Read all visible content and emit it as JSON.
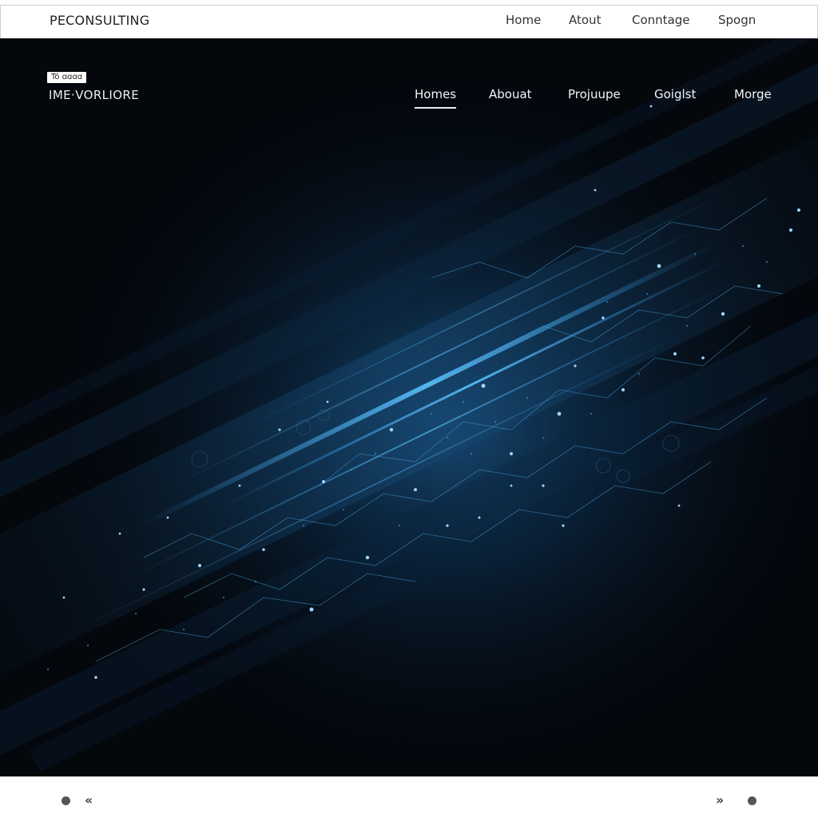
{
  "top_bar": {
    "logo": "PECONSULTING",
    "nav": [
      "Home",
      "Atout",
      "Conntage",
      "Spogn"
    ]
  },
  "hero": {
    "tag": "Tó ɑɑɑɑ",
    "brand": "IME·VORLIORE",
    "nav": [
      "Homes",
      "Abouat",
      "Projuupe",
      "Goiglst",
      "Morge"
    ],
    "active_nav": "Homes",
    "colors": {
      "background": "#04070c",
      "accent": "#2f8fd6"
    }
  },
  "bottom_bar": {
    "prev_label": "‹‹",
    "next_label": "››"
  }
}
